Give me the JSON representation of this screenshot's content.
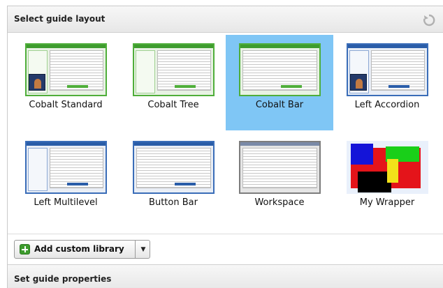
{
  "header": {
    "title": "Select guide layout",
    "refresh_icon": "refresh-icon"
  },
  "layouts": [
    {
      "label": "Cobalt Standard",
      "selected": false
    },
    {
      "label": "Cobalt Tree",
      "selected": false
    },
    {
      "label": "Cobalt Bar",
      "selected": true
    },
    {
      "label": "Left Accordion",
      "selected": false
    },
    {
      "label": "Left Multilevel",
      "selected": false
    },
    {
      "label": "Button Bar",
      "selected": false
    },
    {
      "label": "Workspace",
      "selected": false
    },
    {
      "label": "My Wrapper",
      "selected": false
    }
  ],
  "toolbar": {
    "add_custom_library_label": "Add custom library",
    "add_icon": "plus-icon",
    "dropdown_icon": "chevron-down-icon",
    "dropdown_glyph": "▼"
  },
  "footer": {
    "title": "Set guide properties"
  },
  "colors": {
    "selected_background": "#7fc6f5",
    "green_theme": "#4fae3a",
    "blue_theme": "#2a5da8"
  }
}
